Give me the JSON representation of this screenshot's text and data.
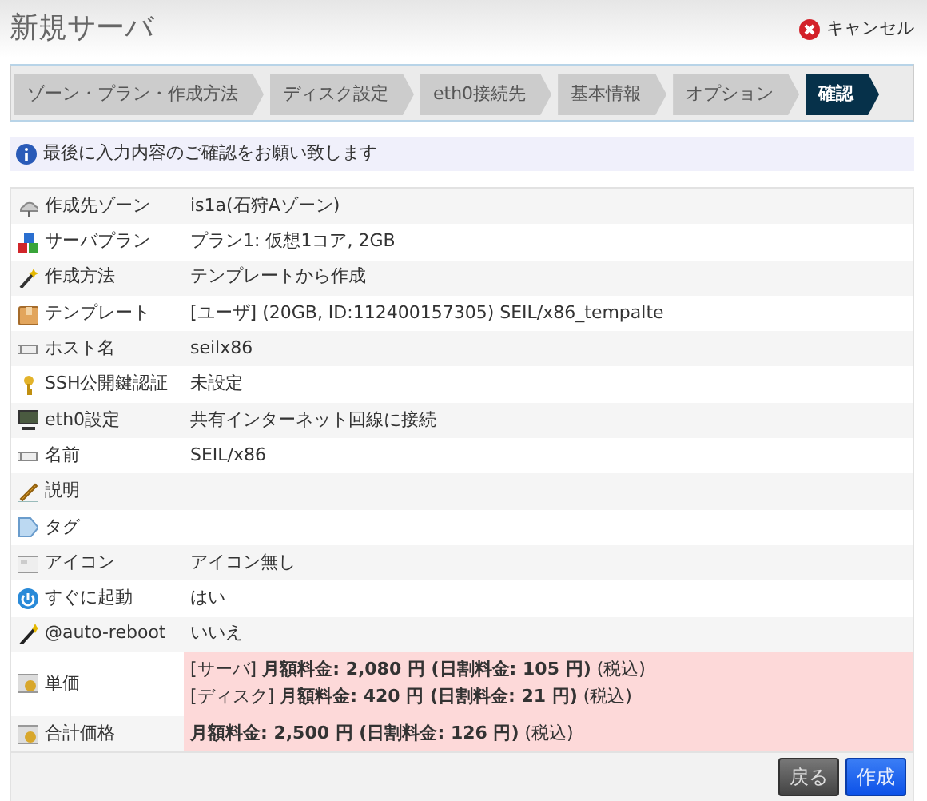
{
  "title": "新規サーバ",
  "cancel": {
    "label": "キャンセル"
  },
  "steps": [
    {
      "label": "ゾーン・プラン・作成方法",
      "selected": false
    },
    {
      "label": "ディスク設定",
      "selected": false
    },
    {
      "label": "eth0接続先",
      "selected": false
    },
    {
      "label": "基本情報",
      "selected": false
    },
    {
      "label": "オプション",
      "selected": false
    },
    {
      "label": "確認",
      "selected": true
    }
  ],
  "info": "最後に入力内容のご確認をお願い致します",
  "rows": [
    {
      "label": "作成先ゾーン",
      "value": [
        "is1a(石狩Aゾーン)"
      ],
      "highlight": false
    },
    {
      "label": "サーバプラン",
      "value": [
        "プラン1: 仮想1コア, 2GB"
      ],
      "highlight": false
    },
    {
      "label": "作成方法",
      "value": [
        "テンプレートから作成"
      ],
      "highlight": false
    },
    {
      "label": "テンプレート",
      "value": [
        "[ユーザ] (20GB, ID:112400157305) SEIL/x86_tempalte"
      ],
      "highlight": false
    },
    {
      "label": "ホスト名",
      "value": [
        "seilx86"
      ],
      "highlight": false
    },
    {
      "label": "SSH公開鍵認証",
      "value": [
        "未設定"
      ],
      "highlight": false
    },
    {
      "label": "eth0設定",
      "value": [
        "共有インターネット回線に接続"
      ],
      "highlight": false
    },
    {
      "label": "名前",
      "value": [
        "SEIL/x86"
      ],
      "highlight": false
    },
    {
      "label": "説明",
      "value": [],
      "highlight": false
    },
    {
      "label": "タグ",
      "value": [],
      "highlight": false
    },
    {
      "label": "アイコン",
      "value": [
        "アイコン無し"
      ],
      "highlight": false
    },
    {
      "label": "すぐに起動",
      "value": [
        "はい"
      ],
      "highlight": false
    },
    {
      "label": "@auto-reboot",
      "value": [
        "いいえ"
      ],
      "highlight": false
    },
    {
      "label": "単価",
      "value": [
        "[サーバ] **月額料金: 2,080 円 (日割料金: 105 円)** (税込)",
        "[ディスク] **月額料金: 420 円 (日割料金: 21 円)** (税込)"
      ],
      "highlight": true
    },
    {
      "label": "合計価格",
      "value": [
        "**月額料金: 2,500 円 (日割料金: 126 円)** (税込)"
      ],
      "highlight": true
    }
  ],
  "buttons": [
    {
      "label": "戻る",
      "kind": "back"
    },
    {
      "label": "作成",
      "kind": "primary"
    }
  ]
}
